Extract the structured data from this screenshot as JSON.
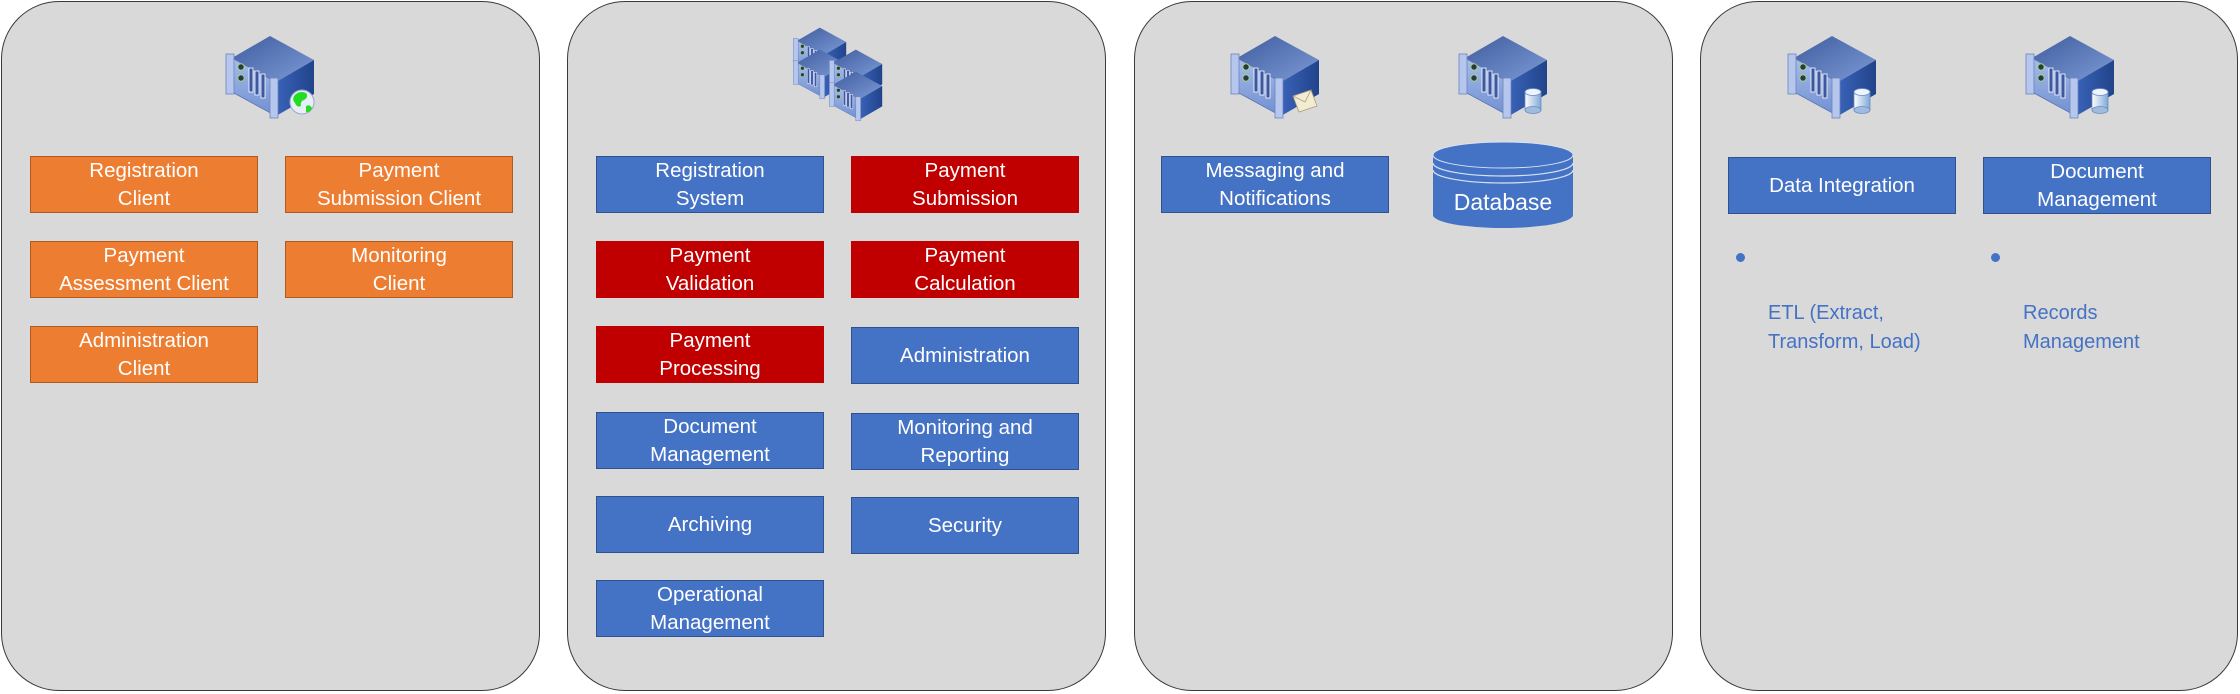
{
  "colors": {
    "panel_bg": "#d9d9d9",
    "client_orange": "#ed7d31",
    "service_blue": "#4472c4",
    "payment_red": "#c00000",
    "bullet_text": "#4472c4"
  },
  "panels": [
    {
      "name": "client-tier",
      "icons": [
        "web-server-icon"
      ],
      "boxes": [
        {
          "label": "Registration\nClient",
          "color": "orange"
        },
        {
          "label": "Payment\nSubmission Client",
          "color": "orange"
        },
        {
          "label": "Payment\nAssessment Client",
          "color": "orange"
        },
        {
          "label": "Monitoring\nClient",
          "color": "orange"
        },
        {
          "label": "Administration\nClient",
          "color": "orange"
        }
      ]
    },
    {
      "name": "application-tier",
      "icons": [
        "server-cluster-icon"
      ],
      "boxes": [
        {
          "label": "Registration\nSystem",
          "color": "blue"
        },
        {
          "label": "Payment\nSubmission",
          "color": "red"
        },
        {
          "label": "Payment\nValidation",
          "color": "red"
        },
        {
          "label": "Payment\nCalculation",
          "color": "red"
        },
        {
          "label": "Payment\nProcessing",
          "color": "red"
        },
        {
          "label": "Administration",
          "color": "blue"
        },
        {
          "label": "Document\nManagement",
          "color": "blue"
        },
        {
          "label": "Monitoring and\nReporting",
          "color": "blue"
        },
        {
          "label": "Archiving",
          "color": "blue"
        },
        {
          "label": "Security",
          "color": "blue"
        },
        {
          "label": "Operational\nManagement",
          "color": "blue"
        }
      ]
    },
    {
      "name": "messaging-data-tier",
      "icons": [
        "mail-server-icon",
        "database-server-icon"
      ],
      "boxes": [
        {
          "label": "Messaging and\nNotifications",
          "color": "blue"
        }
      ],
      "database": {
        "label": "Database",
        "icon": "database-cylinder-icon"
      }
    },
    {
      "name": "integration-tier",
      "icons": [
        "database-server-icon",
        "database-server-icon"
      ],
      "boxes": [
        {
          "label": "Data Integration",
          "color": "blue"
        },
        {
          "label": "Document\nManagement",
          "color": "blue"
        }
      ],
      "bullets": [
        {
          "text": "ETL (Extract,\nTransform, Load)"
        },
        {
          "text": "Records\nManagement"
        }
      ]
    }
  ]
}
